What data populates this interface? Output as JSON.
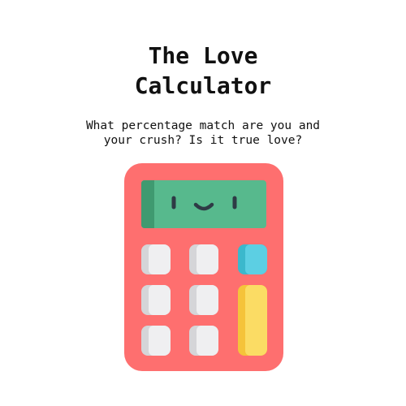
{
  "header": {
    "title_line1": "The Love",
    "title_line2": "Calculator",
    "subtitle_line1": "What percentage match are you and",
    "subtitle_line2": "your crush? Is it true love?"
  },
  "calculator": {
    "body_color": "#fe6f6f",
    "screen_color": "#57b98d",
    "screen_expression": "smiling-face",
    "keys": [
      {
        "name": "key-r1-c1",
        "color": "#efeff1"
      },
      {
        "name": "key-r1-c2",
        "color": "#efeff1"
      },
      {
        "name": "key-r1-c3",
        "color": "#5ccfe3"
      },
      {
        "name": "key-r2-c1",
        "color": "#efeff1"
      },
      {
        "name": "key-r2-c2",
        "color": "#efeff1"
      },
      {
        "name": "key-r3-c1",
        "color": "#efeff1"
      },
      {
        "name": "key-r3-c2",
        "color": "#efeff1"
      },
      {
        "name": "key-equals-tall",
        "color": "#fbdc64"
      }
    ]
  }
}
